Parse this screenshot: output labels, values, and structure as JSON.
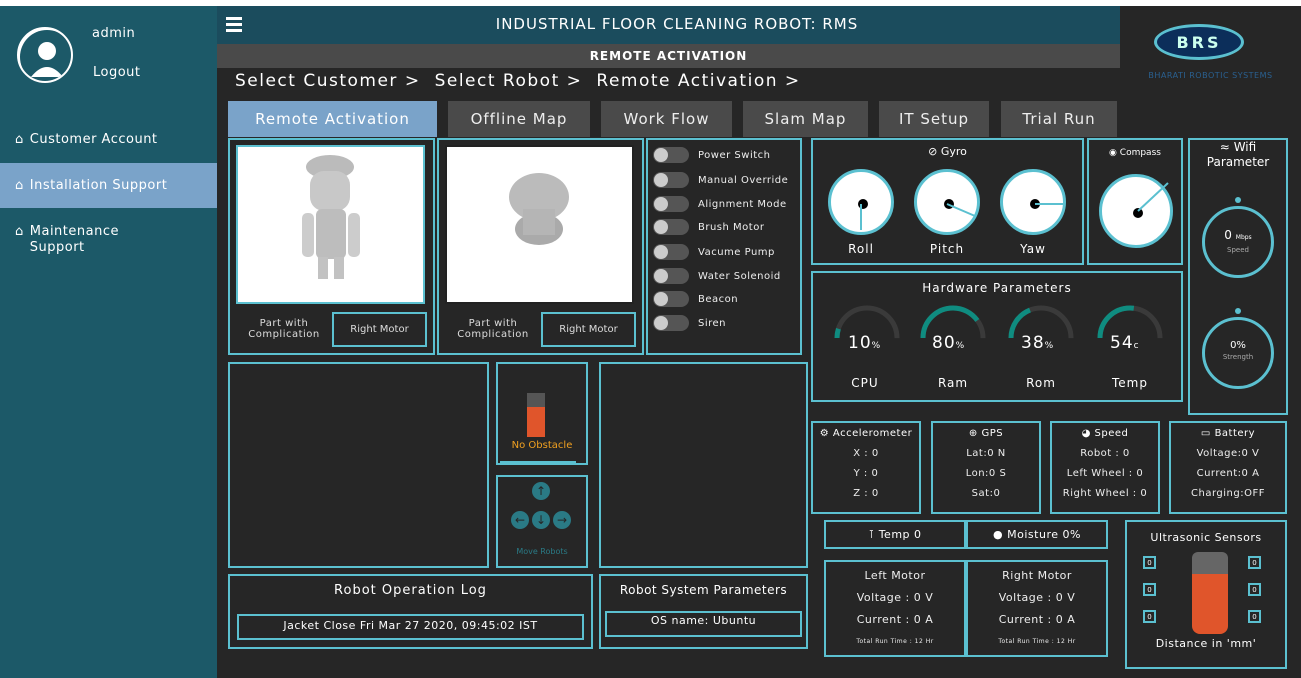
{
  "user": {
    "name": "admin",
    "logout": "Logout"
  },
  "sidebar": {
    "items": [
      {
        "label": "Customer Account"
      },
      {
        "label": "Installation Support"
      },
      {
        "label": "Maintenance Support"
      }
    ]
  },
  "header": {
    "title": "INDUSTRIAL FLOOR CLEANING ROBOT: RMS",
    "subtitle": "REMOTE ACTIVATION"
  },
  "logo": {
    "letters": "BRS",
    "company": "BHARATI ROBOTIC SYSTEMS"
  },
  "breadcrumb": [
    "Select Customer >",
    "Select Robot >",
    "Remote Activation >"
  ],
  "tabs": [
    {
      "label": "Remote Activation"
    },
    {
      "label": "Offline Map"
    },
    {
      "label": "Work Flow"
    },
    {
      "label": "Slam Map"
    },
    {
      "label": "IT Setup"
    },
    {
      "label": "Trial Run"
    }
  ],
  "parts": [
    {
      "caption": "Part with Complication",
      "button": "Right Motor"
    },
    {
      "caption": "Part with Complication",
      "button": "Right Motor"
    }
  ],
  "switches": [
    "Power Switch",
    "Manual Override",
    "Alignment Mode",
    "Brush Motor",
    "Vacume Pump",
    "Water Solenoid",
    "Beacon",
    "Siren"
  ],
  "gyro": {
    "title": "Gyro",
    "dials": [
      "Roll",
      "Pitch",
      "Yaw"
    ]
  },
  "compass": {
    "title": "Compass"
  },
  "wifi": {
    "title": "Wifi Parameter",
    "speed_value": "0",
    "speed_unit": "Mbps",
    "speed_label": "Speed",
    "strength_value": "0%",
    "strength_label": "Strength"
  },
  "hardware": {
    "title": "Hardware Parameters",
    "items": [
      {
        "label": "CPU",
        "value": "10",
        "unit": "%",
        "fraction": 0.1
      },
      {
        "label": "Ram",
        "value": "80",
        "unit": "%",
        "fraction": 0.8
      },
      {
        "label": "Rom",
        "value": "38",
        "unit": "%",
        "fraction": 0.38
      },
      {
        "label": "Temp",
        "value": "54",
        "unit": "c",
        "fraction": 0.54
      }
    ]
  },
  "obstacle": {
    "status": "No Obstacle",
    "move_label": "Move Robots"
  },
  "accelerometer": {
    "title": "Accelerometer",
    "x": "X : 0",
    "y": "Y : 0",
    "z": "Z : 0"
  },
  "gps": {
    "title": "GPS",
    "lat": "Lat:0 N",
    "lon": "Lon:0 S",
    "sat": "Sat:0"
  },
  "speed": {
    "title": "Speed",
    "robot": "Robot : 0",
    "left": "Left Wheel : 0",
    "right": "Right Wheel : 0"
  },
  "battery": {
    "title": "Battery",
    "voltage": "Voltage:0 V",
    "current": "Current:0 A",
    "charging": "Charging:OFF"
  },
  "env": {
    "temp": "Temp 0",
    "moisture": "Moisture 0%"
  },
  "left_motor": {
    "title": "Left Motor",
    "voltage": "Voltage : 0 V",
    "current": "Current : 0 A",
    "runtime": "Total Run Time : 12 Hr"
  },
  "right_motor": {
    "title": "Right Motor",
    "voltage": "Voltage : 0 V",
    "current": "Current : 0 A",
    "runtime": "Total Run Time : 12 Hr"
  },
  "ultrasonic": {
    "title": "Ultrasonic Sensors",
    "values": [
      "0",
      "0",
      "0",
      "0",
      "0",
      "0"
    ],
    "footer": "Distance in 'mm'"
  },
  "log": {
    "title": "Robot Operation Log",
    "entry": "Jacket Close Fri Mar 27 2020, 09:45:02 IST"
  },
  "system": {
    "title": "Robot System Parameters",
    "os": "OS name: Ubuntu"
  },
  "colors": {
    "accent": "#5bc0d0",
    "sidebar": "#1c5968",
    "active_tab": "#7aa3c9",
    "obstacle": "#f0a020"
  }
}
